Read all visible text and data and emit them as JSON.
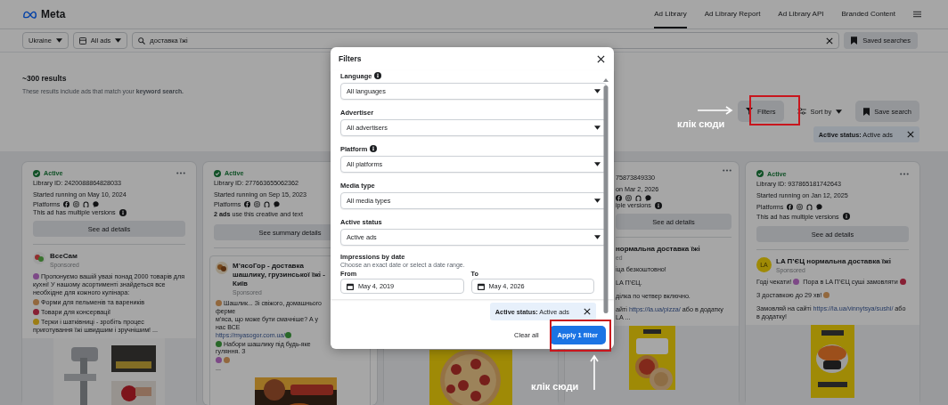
{
  "header": {
    "logo": "Meta",
    "nav": [
      {
        "label": "Ad Library",
        "selected": true
      },
      {
        "label": "Ad Library Report",
        "selected": false
      },
      {
        "label": "Ad Library API",
        "selected": false
      },
      {
        "label": "Branded Content",
        "selected": false
      }
    ]
  },
  "search_bar": {
    "country": "Ukraine",
    "ad_category": "All ads",
    "query": "доставка їжі",
    "saved_searches": "Saved searches"
  },
  "results": {
    "count": "~300 results",
    "note": "These results include ads that match your **keyword search.**"
  },
  "toolbar": {
    "filters": "Filters",
    "sort": "Sort by",
    "save": "Save search",
    "chip": "**Active status:** Active ads"
  },
  "cards": [
    {
      "kind": "plain",
      "status": "Active",
      "library_id": "Library ID: 2420088864828033",
      "started": "Started running on May 10, 2024",
      "platforms": "Platforms",
      "versions": "This ad has multiple versions",
      "button": "See ad details",
      "advertiser": {
        "name": "ВсеСам",
        "sponsored": "Sponsored"
      },
      "body": [
        {
          "parts": [
            {
              "kind": "emoji"
            },
            {
              "kind": "text",
              "text": "Пропонуємо вашій увазі понад 2000 товарів для кухні! У нашому асортименті знайдеться все необхідне для кожного кулінара:"
            }
          ]
        },
        {
          "parts": [
            {
              "kind": "emoji"
            },
            {
              "kind": "text",
              "text": "Форми для пельменів та вареників"
            }
          ]
        },
        {
          "parts": [
            {
              "kind": "emoji"
            },
            {
              "kind": "text",
              "text": "Товари для консервації"
            }
          ]
        },
        {
          "parts": [
            {
              "kind": "emoji"
            },
            {
              "kind": "text",
              "text": "Терки і шатківниці - зробіть процес приготування їжі швидшим і зручнішим! ..."
            }
          ]
        }
      ]
    },
    {
      "kind": "boxed",
      "status": "Active",
      "library_id": "Library ID: 277663655062362",
      "started": "Started running on Sep 15, 2023",
      "platforms": "Platforms",
      "summary": "**2 ads** use this creative and text",
      "button": "See summary details",
      "advertiser": {
        "name": "М’ясоГор - доставка шашлику, грузинської їжі - Київ",
        "sponsored": "Sponsored"
      },
      "body": [
        {
          "parts": [
            {
              "kind": "emoji"
            },
            {
              "kind": "text",
              "text": "Шашлик... Зі свіжого, домашнього ферме"
            }
          ]
        },
        {
          "parts": [
            {
              "kind": "text",
              "text": "м’яса, що може бути смачніше? А у нас ВСЕ"
            }
          ]
        },
        {
          "parts": [
            {
              "kind": "link",
              "text": "https://myasogor.com.ua/"
            },
            {
              "kind": "emoji"
            }
          ]
        },
        {
          "parts": [
            {
              "kind": "emoji"
            },
            {
              "kind": "text",
              "text": "Набори шашлику під будь-яке гуляння. З"
            }
          ]
        },
        {
          "parts": [
            {
              "kind": "emoji"
            },
            {
              "kind": "emoji"
            }
          ]
        },
        {
          "parts": [
            {
              "kind": "text",
              "text": "..."
            }
          ]
        }
      ]
    },
    {
      "kind": "hidden"
    },
    {
      "kind": "cut",
      "library_id": "75873849330",
      "started": "on Mar 2, 2026",
      "versions": "iple versions",
      "button": "See ad details",
      "advertiser": {
        "name": "нормальна доставка їжі",
        "sponsored": "ed"
      },
      "body": [
        {
          "parts": [
            {
              "kind": "text",
              "text": "іца безкоштовно!"
            }
          ]
        },
        {
          "parts": [
            {
              "kind": "text",
              "text": "LA П’ЄЦ."
            }
          ]
        },
        {
          "parts": [
            {
              "kind": "text",
              "text": "ділка по четвер включно."
            }
          ]
        },
        {
          "parts": [
            {
              "kind": "text",
              "text": "айті "
            },
            {
              "kind": "link",
              "text": "https://la.ua/pizza/"
            },
            {
              "kind": "text",
              "text": " або в додатку LA ..."
            }
          ]
        }
      ]
    },
    {
      "kind": "plain",
      "status": "Active",
      "library_id": "Library ID: 937865181742643",
      "started": "Started running on Jan 12, 2025",
      "platforms": "Platforms",
      "versions": "This ad has multiple versions",
      "button": "See ad details",
      "advertiser": {
        "name": "LA П’ЄЦ нормальна доставка їжі",
        "sponsored": "Sponsored",
        "avatar": "LA"
      },
      "body": [
        {
          "parts": [
            {
              "kind": "text",
              "text": "Годі чекати! "
            },
            {
              "kind": "emoji"
            },
            {
              "kind": "text",
              "text": " Пора в LA П’ЄЦ суші замовляти "
            },
            {
              "kind": "emoji"
            }
          ]
        },
        {
          "parts": [
            {
              "kind": "text",
              "text": "З доставкою до 29 хв! "
            },
            {
              "kind": "emoji"
            }
          ]
        },
        {
          "parts": [
            {
              "kind": "text",
              "text": "Замовляй на сайті "
            },
            {
              "kind": "link",
              "text": "https://la.ua/vinnytsya/sushi/"
            },
            {
              "kind": "text",
              "text": " або в додатку!"
            }
          ]
        }
      ]
    }
  ],
  "filters_dialog": {
    "title": "Filters",
    "fields": [
      {
        "label": "Language",
        "info": true,
        "value": "All languages"
      },
      {
        "label": "Advertiser",
        "info": false,
        "value": "All advertisers"
      },
      {
        "label": "Platform",
        "info": true,
        "value": "All platforms"
      },
      {
        "label": "Media type",
        "info": false,
        "value": "All media types"
      },
      {
        "label": "Active status",
        "info": false,
        "value": "Active ads"
      }
    ],
    "dates": {
      "label": "Impressions by date",
      "hint": "Choose an exact date or select a date range.",
      "from_label": "From",
      "to_label": "To",
      "from": "May 4, 2019",
      "to": "May 4, 2026"
    },
    "chip": "**Active status:** Active ads",
    "clear": "Clear all",
    "apply": "Apply 1 filter"
  },
  "annotations": [
    {
      "text": "клік сюди",
      "kind": "right"
    },
    {
      "text": "клік сюди",
      "kind": "up"
    }
  ]
}
